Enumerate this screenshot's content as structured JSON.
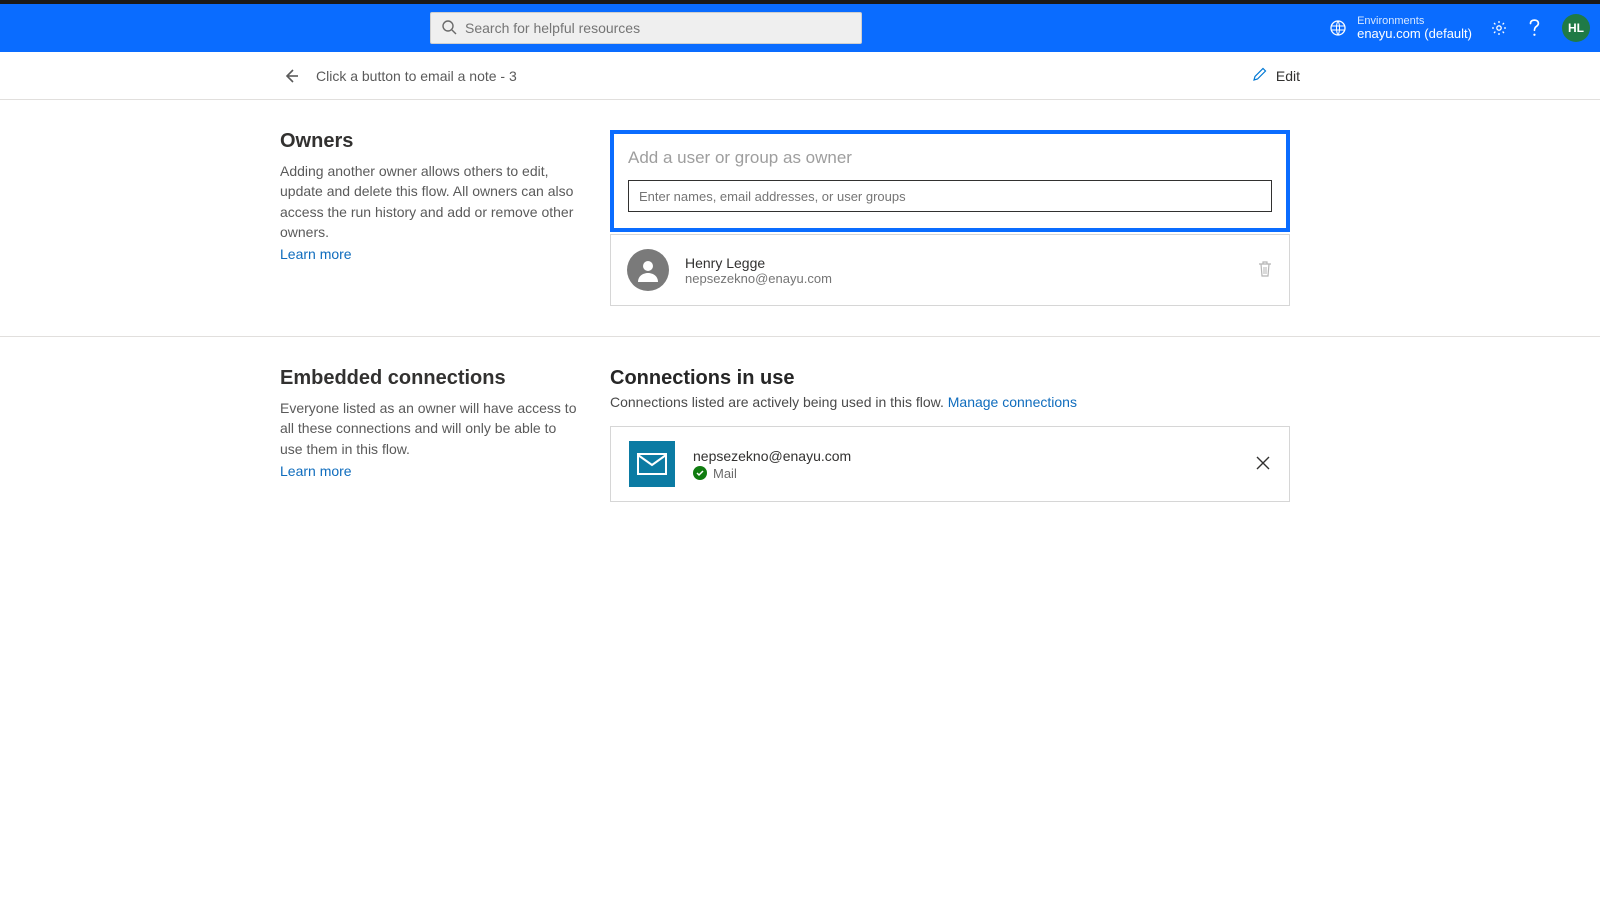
{
  "header": {
    "search_placeholder": "Search for helpful resources",
    "env_label": "Environments",
    "env_name": "enayu.com (default)",
    "avatar_initials": "HL"
  },
  "subbar": {
    "flow_title": "Click a button to email a note - 3",
    "edit_label": "Edit"
  },
  "owners_section": {
    "title": "Owners",
    "description": "Adding another owner allows others to edit, update and delete this flow. All owners can also access the run history and add or remove other owners.",
    "learn_more": "Learn more",
    "add_title": "Add a user or group as owner",
    "input_placeholder": "Enter names, email addresses, or user groups",
    "owner": {
      "name": "Henry Legge",
      "email": "nepsezekno@enayu.com"
    }
  },
  "connections_section": {
    "left_title": "Embedded connections",
    "left_description": "Everyone listed as an owner will have access to all these connections and will only be able to use them in this flow.",
    "learn_more": "Learn more",
    "right_title": "Connections in use",
    "right_sub": "Connections listed are actively being used in this flow.",
    "manage_link": "Manage connections",
    "connection": {
      "email": "nepsezekno@enayu.com",
      "service": "Mail"
    }
  }
}
